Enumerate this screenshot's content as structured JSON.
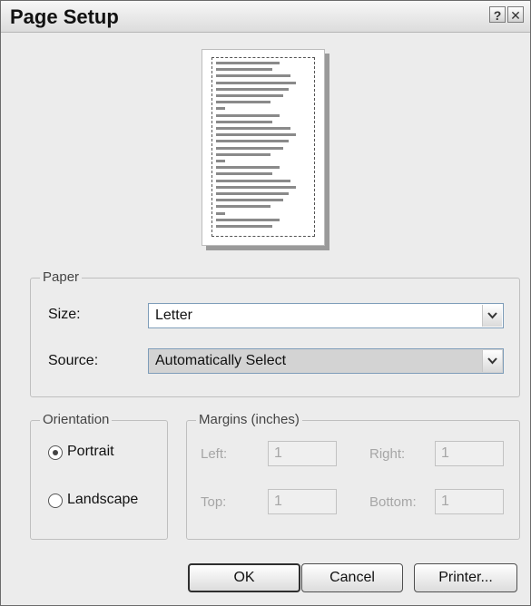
{
  "window": {
    "title": "Page Setup",
    "help_glyph": "?",
    "close_glyph": "✕"
  },
  "paper": {
    "legend": "Paper",
    "size_label": "Size:",
    "size_value": "Letter",
    "source_label": "Source:",
    "source_value": "Automatically Select"
  },
  "orientation": {
    "legend": "Orientation",
    "portrait_label": "Portrait",
    "landscape_label": "Landscape",
    "selected": "Portrait"
  },
  "margins": {
    "legend": "Margins (inches)",
    "left_label": "Left:",
    "left_value": "1",
    "right_label": "Right:",
    "right_value": "1",
    "top_label": "Top:",
    "top_value": "1",
    "bottom_label": "Bottom:",
    "bottom_value": "1"
  },
  "buttons": {
    "ok": "OK",
    "cancel": "Cancel",
    "printer": "Printer..."
  },
  "icons": {
    "dropdown": "chevron-down-icon",
    "help": "help-icon",
    "close": "close-icon"
  }
}
